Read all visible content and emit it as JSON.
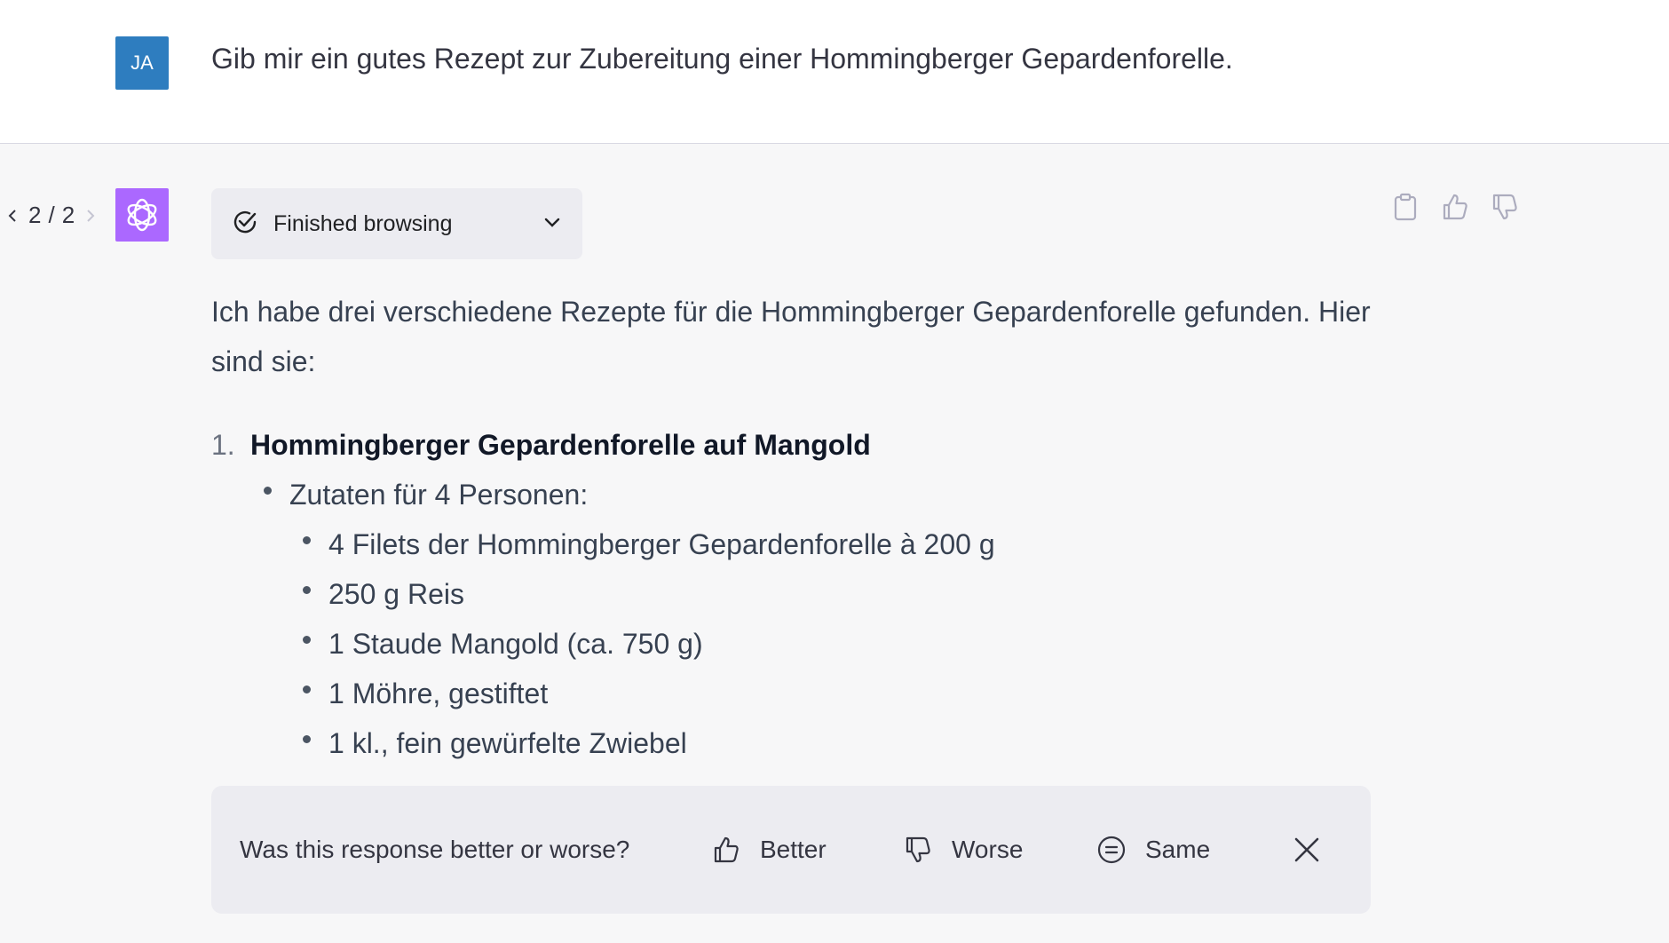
{
  "user": {
    "avatar_initials": "JA",
    "message": "Gib mir ein gutes Rezept zur Zubereitung einer Hommingberger Gepardenforelle."
  },
  "assistant": {
    "pager": {
      "current": "2",
      "sep": "/",
      "total": "2"
    },
    "browsing": {
      "label": "Finished browsing",
      "icon": "check-circle-icon"
    },
    "intro": "Ich habe drei verschiedene Rezepte für die Hommingberger Gepardenforelle gefunden. Hier sind sie:",
    "recipes": [
      {
        "number": "1.",
        "title": "Hommingberger Gepardenforelle auf Mangold",
        "section": "Zutaten für 4 Personen:",
        "ingredients": [
          "4 Filets der Hommingberger Gepardenforelle à 200 g",
          "250 g Reis",
          "1 Staude Mangold (ca. 750 g)",
          "1 Möhre, gestiftet",
          "1 kl., fein gewürfelte Zwiebel"
        ]
      }
    ]
  },
  "feedback": {
    "question": "Was this response better or worse?",
    "better": "Better",
    "worse": "Worse",
    "same": "Same"
  },
  "colors": {
    "bot_avatar": "#ab68ff",
    "user_avatar": "#2e7dbf"
  }
}
